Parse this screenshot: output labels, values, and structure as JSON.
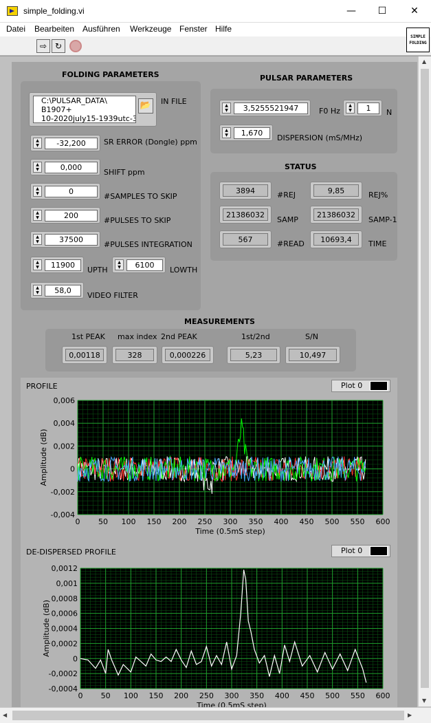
{
  "window": {
    "title": "simple_folding.vi",
    "minimize": "—",
    "maximize": "☐",
    "close": "✕"
  },
  "menu": [
    "Datei",
    "Bearbeiten",
    "Ausführen",
    "Werkzeuge",
    "Fenster",
    "Hilfe"
  ],
  "toolbar": {
    "run_icon": "run-arrow-icon",
    "run_cont_icon": "run-continuously-icon",
    "abort_icon": "abort-stop-icon"
  },
  "vi_icon": {
    "line1": "SIMPLE",
    "line2": "FOLDING"
  },
  "folding": {
    "heading": "FOLDING PARAMETERS",
    "in_file_label": "IN FILE",
    "in_file_lines": [
      "C:\\PULSAR_DATA\\",
      "B1907+",
      "10-2020july15-1939utc-3"
    ],
    "sr_error": {
      "value": "-32,200",
      "label": "SR ERROR (Dongle) ppm"
    },
    "shift": {
      "value": "0,000",
      "label": "SHIFT ppm"
    },
    "samples_skip": {
      "value": "0",
      "label": "#SAMPLES TO SKIP"
    },
    "pulses_skip": {
      "value": "200",
      "label": "#PULSES TO SKIP"
    },
    "pulses_integration": {
      "value": "37500",
      "label": "#PULSES INTEGRATION"
    },
    "upth": {
      "value": "11900",
      "label": "UPTH"
    },
    "lowth": {
      "value": "6100",
      "label": "LOWTH"
    },
    "video_filter": {
      "value": "58,0",
      "label": "VIDEO FILTER"
    }
  },
  "pulsar": {
    "heading": "PULSAR PARAMETERS",
    "f0": {
      "value": "3,5255521947",
      "label": "F0 Hz"
    },
    "n": {
      "value": "1",
      "label": "N"
    },
    "dispersion": {
      "value": "1,670",
      "label": "DISPERSION (mS/MHz)"
    }
  },
  "status": {
    "heading": "STATUS",
    "rej": {
      "value": "3894",
      "label": "#REJ"
    },
    "rej_pct": {
      "value": "9,85",
      "label": "REJ%"
    },
    "samp": {
      "value": "21386032",
      "label": "SAMP"
    },
    "samp_1": {
      "value": "21386032",
      "label": "SAMP-1"
    },
    "read": {
      "value": "567",
      "label": "#READ"
    },
    "time": {
      "value": "10693,4",
      "label": "TIME"
    }
  },
  "measurements": {
    "heading": "MEASUREMENTS",
    "first_peak": {
      "label": "1st PEAK",
      "value": "0,00118"
    },
    "max_index": {
      "label": "max index",
      "value": "328"
    },
    "second_peak": {
      "label": "2nd PEAK",
      "value": "0,000226"
    },
    "ratio": {
      "label": "1st/2nd",
      "value": "5,23"
    },
    "sn": {
      "label": "S/N",
      "value": "10,497"
    }
  },
  "chart_data": [
    {
      "type": "line",
      "title": "PROFILE",
      "legend": "Plot 0",
      "xlabel": "Time (0.5mS step)",
      "ylabel": "Amplitude (dB)",
      "xlim": [
        0,
        600
      ],
      "ylim": [
        -0.004,
        0.006
      ],
      "xticks": [
        "0",
        "50",
        "100",
        "150",
        "200",
        "250",
        "300",
        "350",
        "400",
        "450",
        "500",
        "550",
        "600"
      ],
      "yticks": [
        "-0,004",
        "-0,002",
        "0",
        "0,002",
        "0,004",
        "0,006"
      ],
      "grid": true,
      "series_colors": [
        "#ffffff",
        "#ff3030",
        "#00ff00",
        "#4aa8ff"
      ],
      "noise_amplitude": 0.0011,
      "x_points": 567,
      "peak": {
        "x": 322,
        "y": 0.0045
      }
    },
    {
      "type": "line",
      "title": "DE-DISPERSED PROFILE",
      "legend": "Plot 0",
      "xlabel": "Time (0.5mS step)",
      "ylabel": "Amplitude (dB)",
      "xlim": [
        0,
        600
      ],
      "ylim": [
        -0.0004,
        0.0012
      ],
      "xticks": [
        "0",
        "50",
        "100",
        "150",
        "200",
        "250",
        "300",
        "350",
        "400",
        "450",
        "500",
        "550",
        "600"
      ],
      "yticks": [
        "-0,0004",
        "-0,0002",
        "0",
        "0,0002",
        "0,0004",
        "0,0006",
        "0,0008",
        "0,001",
        "0,0012"
      ],
      "grid": true,
      "series_colors": [
        "#ffffff"
      ],
      "x": [
        0,
        15,
        30,
        40,
        50,
        55,
        62,
        75,
        85,
        100,
        110,
        120,
        130,
        140,
        150,
        160,
        170,
        180,
        190,
        200,
        210,
        220,
        230,
        240,
        250,
        260,
        270,
        280,
        290,
        300,
        310,
        318,
        324,
        328,
        333,
        338,
        345,
        355,
        365,
        375,
        385,
        395,
        405,
        415,
        425,
        440,
        455,
        470,
        485,
        500,
        515,
        530,
        545,
        560,
        567
      ],
      "values": [
        0.0,
        -2e-05,
        -0.00013,
        -2e-05,
        -0.0002,
        0.00012,
        -2e-05,
        -0.00022,
        -8e-05,
        -0.00018,
        2e-05,
        -4e-05,
        -0.0001,
        6e-05,
        -2e-05,
        -4e-05,
        2e-05,
        -4e-05,
        0.00012,
        -2e-05,
        -0.00012,
        0.0001,
        -8e-05,
        -4e-05,
        0.00016,
        -0.0001,
        4e-05,
        -8e-05,
        0.00022,
        -0.00014,
        4e-05,
        0.0006,
        0.00118,
        0.00105,
        0.0005,
        0.00036,
        0.00012,
        -6e-05,
        4e-05,
        -0.00024,
        4e-05,
        -0.0002,
        0.00018,
        -4e-05,
        0.00022,
        -0.0001,
        4e-05,
        -0.00018,
        8e-05,
        -0.00014,
        6e-05,
        -0.00016,
        0.00012,
        -0.00014,
        -0.00032
      ]
    }
  ]
}
